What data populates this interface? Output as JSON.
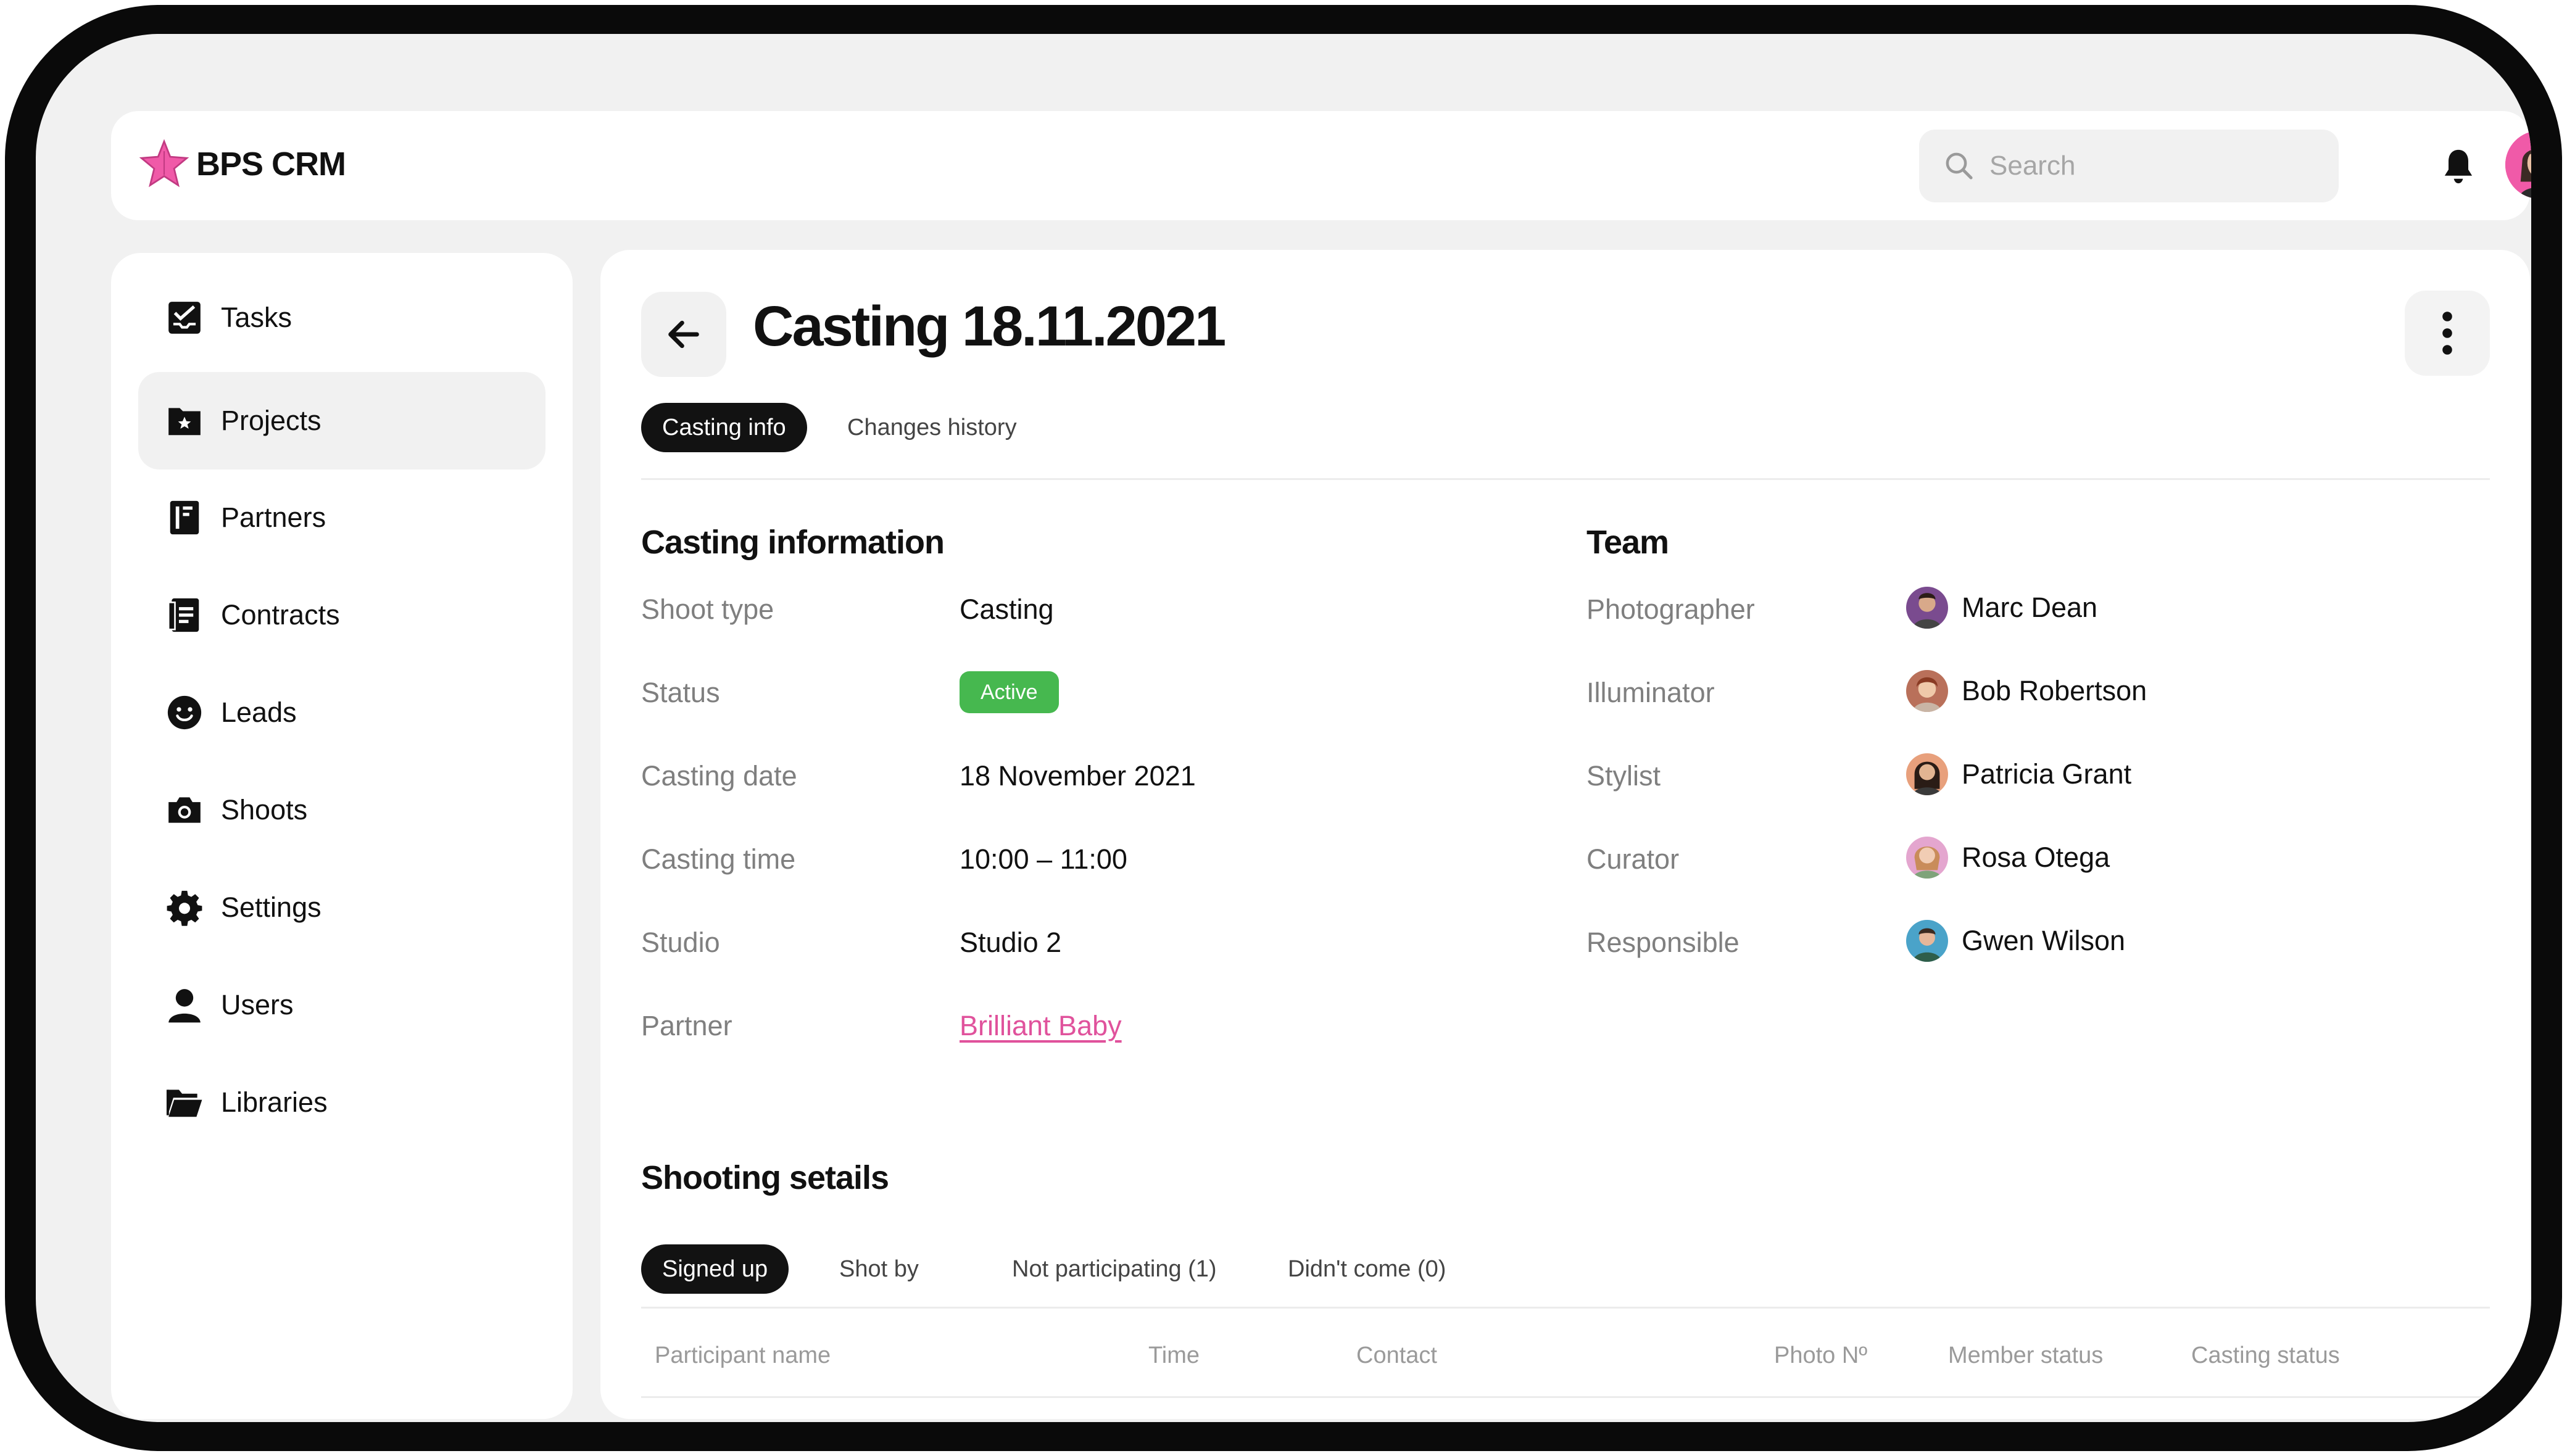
{
  "app": {
    "name": "BPS CRM"
  },
  "colors": {
    "accent": "#e0529c",
    "active_badge": "#46b84f",
    "dark": "#121212"
  },
  "header": {
    "search_placeholder": "Search"
  },
  "sidebar": {
    "items": [
      {
        "label": "Tasks",
        "icon": "tasks-icon"
      },
      {
        "label": "Projects",
        "icon": "projects-icon",
        "active": true
      },
      {
        "label": "Partners",
        "icon": "partners-icon"
      },
      {
        "label": "Contracts",
        "icon": "contracts-icon"
      },
      {
        "label": "Leads",
        "icon": "leads-icon"
      },
      {
        "label": "Shoots",
        "icon": "camera-icon"
      },
      {
        "label": "Settings",
        "icon": "gear-icon"
      },
      {
        "label": "Users",
        "icon": "user-icon"
      },
      {
        "label": "Libraries",
        "icon": "folder-icon"
      }
    ]
  },
  "page": {
    "title": "Casting 18.11.2021",
    "tabs": [
      {
        "label": "Casting info",
        "active": true
      },
      {
        "label": "Changes history"
      }
    ]
  },
  "casting_info": {
    "title": "Casting information",
    "shoot_type": {
      "label": "Shoot type",
      "value": "Casting"
    },
    "status": {
      "label": "Status",
      "value": "Active"
    },
    "casting_date": {
      "label": "Casting date",
      "value": "18 November 2021"
    },
    "casting_time": {
      "label": "Casting time",
      "value": "10:00 – 11:00"
    },
    "studio": {
      "label": "Studio",
      "value": "Studio 2"
    },
    "partner": {
      "label": "Partner",
      "value": "Brilliant Baby"
    }
  },
  "team": {
    "title": "Team",
    "members": [
      {
        "role": "Photographer",
        "name": "Marc Dean"
      },
      {
        "role": "Illuminator",
        "name": "Bob Robertson"
      },
      {
        "role": "Stylist",
        "name": "Patricia Grant"
      },
      {
        "role": "Curator",
        "name": "Rosa Otega"
      },
      {
        "role": "Responsible",
        "name": "Gwen Wilson"
      }
    ]
  },
  "shooting": {
    "title": "Shooting setails",
    "tabs": [
      {
        "label": "Signed up",
        "active": true
      },
      {
        "label": "Shot by"
      },
      {
        "label": "Not participating (1)"
      },
      {
        "label": "Didn't come (0)"
      }
    ],
    "columns": [
      "Participant name",
      "Time",
      "Contact",
      "Photo Nº",
      "Member status",
      "Casting status"
    ]
  }
}
